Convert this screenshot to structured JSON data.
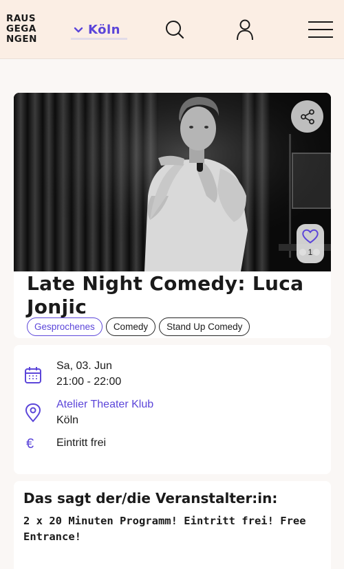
{
  "header": {
    "logo_lines": [
      "RAUS",
      "GEGA",
      "NGEN"
    ],
    "city": "Köln",
    "icons": [
      "chevron-down-icon",
      "search-icon",
      "user-icon",
      "menu-icon"
    ]
  },
  "event": {
    "title": "Late Night Comedy: Luca Jonjic",
    "tags": [
      "Gesprochenes",
      "Comedy",
      "Stand Up Comedy"
    ],
    "favorite_count": "1",
    "date": "Sa, 03. Jun",
    "time": "21:00 - 22:00",
    "venue": "Atelier Theater Klub",
    "venue_city": "Köln",
    "price_symbol": "€",
    "price": "Eintritt frei"
  },
  "organizer": {
    "heading": "Das sagt der/die Veranstalter:in:",
    "text": "2 x 20 Minuten Programm! Eintritt frei! Free Entrance!"
  },
  "colors": {
    "accent": "#5b45d9",
    "header_bg": "#fbeee4",
    "page_bg": "#faf7f5"
  }
}
